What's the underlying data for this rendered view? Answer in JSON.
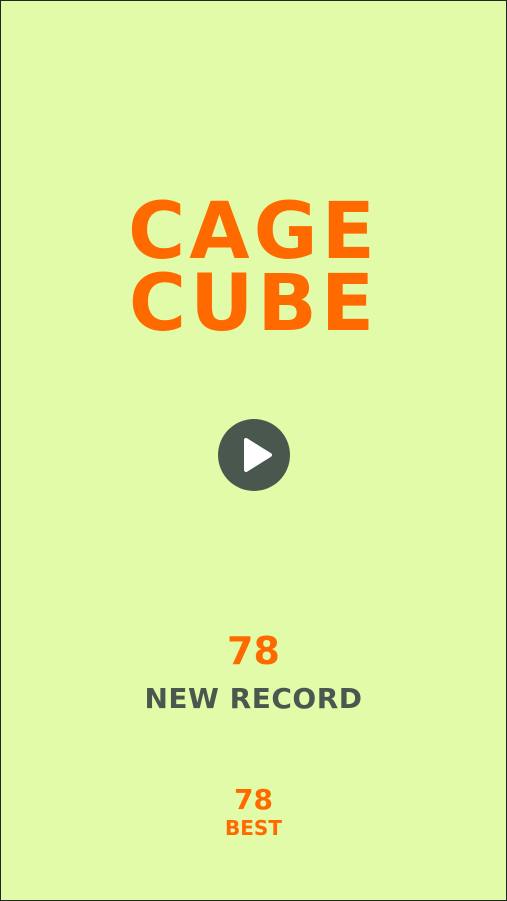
{
  "title": {
    "line1": "CAGE",
    "line2": "CUBE"
  },
  "play_button": {
    "icon": "play-icon"
  },
  "score": {
    "value": "78",
    "status": "NEW RECORD"
  },
  "best": {
    "value": "78",
    "label": "BEST"
  },
  "colors": {
    "background": "#e2fba8",
    "accent": "#ff6a00",
    "dark": "#4a574f"
  }
}
